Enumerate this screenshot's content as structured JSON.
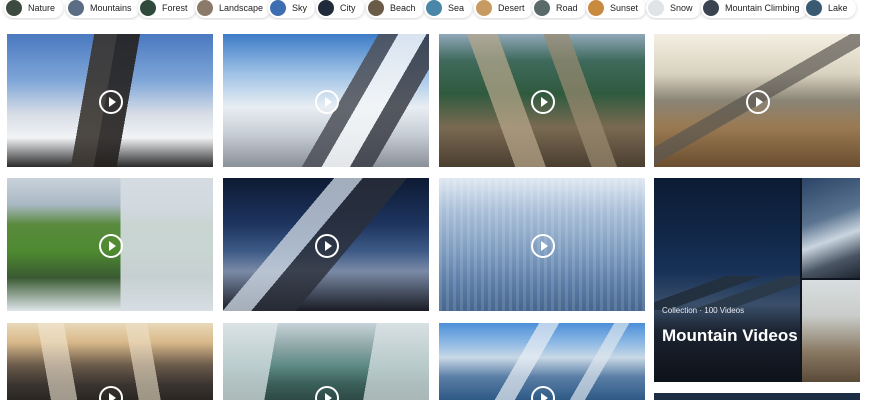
{
  "tags": [
    {
      "label": "Nature",
      "color": "#3d4a3f"
    },
    {
      "label": "Mountains",
      "color": "#5b6d84"
    },
    {
      "label": "Forest",
      "color": "#2f4a3a"
    },
    {
      "label": "Landscape",
      "color": "#8a7a6a"
    },
    {
      "label": "Sky",
      "color": "#3d6fb0"
    },
    {
      "label": "City",
      "color": "#1f2a3a"
    },
    {
      "label": "Beach",
      "color": "#6a5a48"
    },
    {
      "label": "Sea",
      "color": "#4a86a8"
    },
    {
      "label": "Desert",
      "color": "#c79a62"
    },
    {
      "label": "Road",
      "color": "#5a6a6a"
    },
    {
      "label": "Sunset",
      "color": "#c98a40"
    },
    {
      "label": "Snow",
      "color": "#e0e4e8"
    },
    {
      "label": "Mountain Climbing",
      "color": "#3a4450"
    },
    {
      "label": "Lake",
      "color": "#3a5a72"
    }
  ],
  "videos": [
    {
      "name": "video-cliff-above-clouds"
    },
    {
      "name": "video-snowy-ridge"
    },
    {
      "name": "video-green-rocky-peaks"
    },
    {
      "name": "video-golden-valley"
    },
    {
      "name": "video-sea-cliffs"
    },
    {
      "name": "video-starry-mountain"
    },
    {
      "name": "video-snowy-forest"
    },
    {
      "name": "video-sunrise-peaks"
    },
    {
      "name": "video-misty-lake"
    },
    {
      "name": "video-alpine-lake"
    }
  ],
  "collection": {
    "meta": "Collection · 100 Videos",
    "title": "Mountain Videos"
  }
}
